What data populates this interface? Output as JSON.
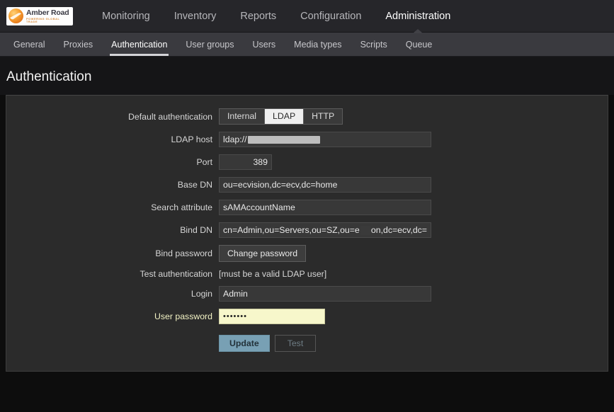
{
  "header": {
    "logo": {
      "name": "Amber Road",
      "tagline": "POWERING GLOBAL TRADE"
    },
    "nav": [
      {
        "label": "Monitoring",
        "active": false
      },
      {
        "label": "Inventory",
        "active": false
      },
      {
        "label": "Reports",
        "active": false
      },
      {
        "label": "Configuration",
        "active": false
      },
      {
        "label": "Administration",
        "active": true
      }
    ]
  },
  "subnav": [
    {
      "label": "General",
      "active": false
    },
    {
      "label": "Proxies",
      "active": false
    },
    {
      "label": "Authentication",
      "active": true
    },
    {
      "label": "User groups",
      "active": false
    },
    {
      "label": "Users",
      "active": false
    },
    {
      "label": "Media types",
      "active": false
    },
    {
      "label": "Scripts",
      "active": false
    },
    {
      "label": "Queue",
      "active": false
    }
  ],
  "page": {
    "title": "Authentication"
  },
  "form": {
    "default_auth": {
      "label": "Default authentication",
      "options": [
        "Internal",
        "LDAP",
        "HTTP"
      ],
      "selected": "LDAP"
    },
    "ldap_host": {
      "label": "LDAP host",
      "value": "ldap://"
    },
    "port": {
      "label": "Port",
      "value": "389"
    },
    "base_dn": {
      "label": "Base DN",
      "value": "ou=ecvision,dc=ecv,dc=home"
    },
    "search_attribute": {
      "label": "Search attribute",
      "value": "sAMAccountName"
    },
    "bind_dn": {
      "label": "Bind DN",
      "value_start": "cn=Admin,ou=Servers,ou=SZ,ou=e",
      "value_end": "on,dc=ecv,dc="
    },
    "bind_password": {
      "label": "Bind password",
      "button": "Change password"
    },
    "test_authentication": {
      "label": "Test authentication",
      "hint": "[must be a valid LDAP user]"
    },
    "login": {
      "label": "Login",
      "value": "Admin"
    },
    "user_password": {
      "label": "User password",
      "value": "•••••••"
    },
    "actions": {
      "update": "Update",
      "test": "Test"
    }
  },
  "colors": {
    "accent_primary": "#78a0b4",
    "highlight_field": "#f7f7cb",
    "topbar": "#26262a",
    "subnav": "#3a3a3f",
    "panel": "#2b2b2b"
  }
}
